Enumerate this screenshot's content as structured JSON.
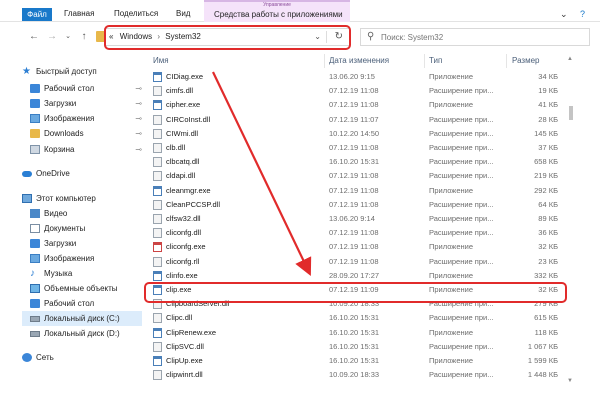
{
  "ribbon": {
    "tabs": [
      "Файл",
      "Главная",
      "Поделиться",
      "Вид"
    ],
    "context_group_title": "Управление",
    "context_tab": "Средства работы с приложениями",
    "collapse_glyph": "⌄",
    "help_glyph": "?"
  },
  "address": {
    "path_prefix": "«",
    "path": [
      "Windows",
      "System32"
    ],
    "sep": "›",
    "dropdown": "⌄",
    "refresh": "↻"
  },
  "search": {
    "placeholder": "Поиск: System32"
  },
  "sidebar": {
    "items": [
      {
        "label": "Быстрый доступ",
        "icon": "star-icon",
        "pinned": false
      },
      {
        "label": "Рабочий стол",
        "icon": "desktop-icon",
        "pinned": true
      },
      {
        "label": "Загрузки",
        "icon": "downloads-icon",
        "pinned": true
      },
      {
        "label": "Изображения",
        "icon": "pictures-icon",
        "pinned": true
      },
      {
        "label": "Downloads",
        "icon": "folder-icon",
        "pinned": true
      },
      {
        "label": "Корзина",
        "icon": "recycle-bin-icon",
        "pinned": true
      },
      {
        "label": "OneDrive",
        "icon": "onedrive-icon",
        "pinned": false
      },
      {
        "label": "Этот компьютер",
        "icon": "computer-icon",
        "pinned": false
      },
      {
        "label": "Видео",
        "icon": "videos-icon",
        "pinned": false
      },
      {
        "label": "Документы",
        "icon": "documents-icon",
        "pinned": false
      },
      {
        "label": "Загрузки",
        "icon": "downloads-icon",
        "pinned": false
      },
      {
        "label": "Изображения",
        "icon": "pictures-icon",
        "pinned": false
      },
      {
        "label": "Музыка",
        "icon": "music-icon",
        "pinned": false
      },
      {
        "label": "Объемные объекты",
        "icon": "3d-objects-icon",
        "pinned": false
      },
      {
        "label": "Рабочий стол",
        "icon": "desktop-icon",
        "pinned": false
      },
      {
        "label": "Локальный диск (C:)",
        "icon": "drive-icon",
        "pinned": false,
        "selected": true
      },
      {
        "label": "Локальный диск (D:)",
        "icon": "drive-icon",
        "pinned": false
      },
      {
        "label": "Сеть",
        "icon": "network-icon",
        "pinned": false
      }
    ],
    "pin_glyph": "📌"
  },
  "list": {
    "columns": {
      "name": "Имя",
      "date": "Дата изменения",
      "type": "Тип",
      "size": "Размер"
    },
    "rows": [
      {
        "name": "CIDiag.exe",
        "date": "13.06.20 9:15",
        "type": "Приложение",
        "size": "34 КБ",
        "kind": "app"
      },
      {
        "name": "cimfs.dll",
        "date": "07.12.19 11:08",
        "type": "Расширение при...",
        "size": "19 КБ",
        "kind": "dll"
      },
      {
        "name": "cipher.exe",
        "date": "07.12.19 11:08",
        "type": "Приложение",
        "size": "41 КБ",
        "kind": "app"
      },
      {
        "name": "CIRCoInst.dll",
        "date": "07.12.19 11:07",
        "type": "Расширение при...",
        "size": "28 КБ",
        "kind": "dll"
      },
      {
        "name": "CIWmi.dll",
        "date": "10.12.20 14:50",
        "type": "Расширение при...",
        "size": "145 КБ",
        "kind": "dll"
      },
      {
        "name": "clb.dll",
        "date": "07.12.19 11:08",
        "type": "Расширение при...",
        "size": "37 КБ",
        "kind": "dll"
      },
      {
        "name": "clbcatq.dll",
        "date": "16.10.20 15:31",
        "type": "Расширение при...",
        "size": "658 КБ",
        "kind": "dll"
      },
      {
        "name": "cldapi.dll",
        "date": "07.12.19 11:08",
        "type": "Расширение при...",
        "size": "219 КБ",
        "kind": "dll"
      },
      {
        "name": "cleanmgr.exe",
        "date": "07.12.19 11:08",
        "type": "Приложение",
        "size": "292 КБ",
        "kind": "app"
      },
      {
        "name": "CleanPCCSP.dll",
        "date": "07.12.19 11:08",
        "type": "Расширение при...",
        "size": "64 КБ",
        "kind": "dll"
      },
      {
        "name": "clfsw32.dll",
        "date": "13.06.20 9:14",
        "type": "Расширение при...",
        "size": "89 КБ",
        "kind": "dll"
      },
      {
        "name": "cliconfg.dll",
        "date": "07.12.19 11:08",
        "type": "Расширение при...",
        "size": "36 КБ",
        "kind": "dll"
      },
      {
        "name": "cliconfg.exe",
        "date": "07.12.19 11:08",
        "type": "Приложение",
        "size": "32 КБ",
        "kind": "app-r"
      },
      {
        "name": "cliconfg.rll",
        "date": "07.12.19 11:08",
        "type": "Расширение при...",
        "size": "23 КБ",
        "kind": "dll"
      },
      {
        "name": "clinfo.exe",
        "date": "28.09.20 17:27",
        "type": "Приложение",
        "size": "332 КБ",
        "kind": "app"
      },
      {
        "name": "clip.exe",
        "date": "07.12.19 11:09",
        "type": "Приложение",
        "size": "32 КБ",
        "kind": "app"
      },
      {
        "name": "ClipboardServer.dll",
        "date": "10.09.20 18:33",
        "type": "Расширение при...",
        "size": "279 КБ",
        "kind": "dll"
      },
      {
        "name": "Clipc.dll",
        "date": "16.10.20 15:31",
        "type": "Расширение при...",
        "size": "615 КБ",
        "kind": "dll"
      },
      {
        "name": "ClipRenew.exe",
        "date": "16.10.20 15:31",
        "type": "Приложение",
        "size": "118 КБ",
        "kind": "app"
      },
      {
        "name": "ClipSVC.dll",
        "date": "16.10.20 15:31",
        "type": "Расширение при...",
        "size": "1 067 КБ",
        "kind": "dll"
      },
      {
        "name": "ClipUp.exe",
        "date": "16.10.20 15:31",
        "type": "Приложение",
        "size": "1 599 КБ",
        "kind": "app"
      },
      {
        "name": "clipwinrt.dll",
        "date": "10.09.20 18:33",
        "type": "Расширение при...",
        "size": "1 448 КБ",
        "kind": "dll"
      }
    ]
  },
  "colors": {
    "annotation": "#e12b2b",
    "file_tab": "#1979ca",
    "context_tab": "#f5e3fa",
    "selection": "#dcecfb"
  }
}
